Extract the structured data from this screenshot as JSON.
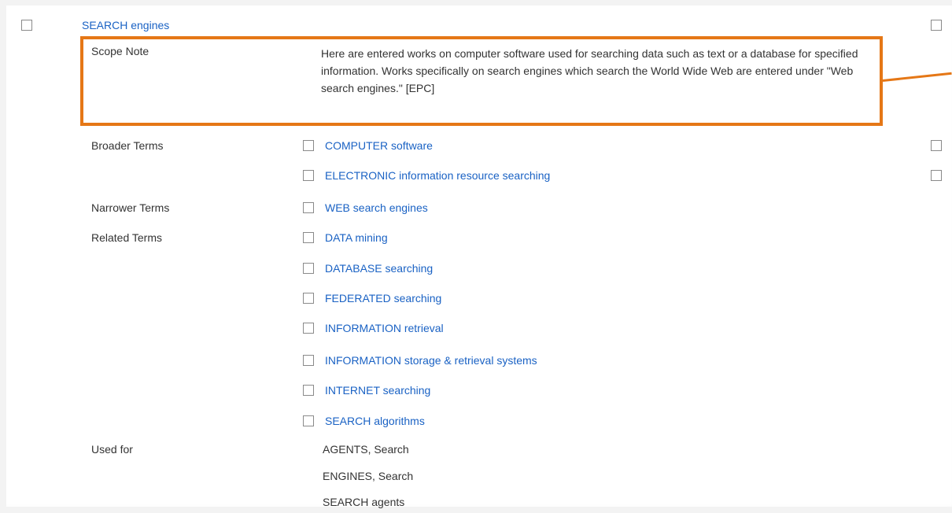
{
  "entry": {
    "heading": "SEARCH engines"
  },
  "scope_note": {
    "label": "Scope Note",
    "text": "Here are entered works on computer software used for searching data such as text or a database for specified information. Works specifically on search engines which search the World Wide Web are entered under \"Web search engines.\" [EPC]"
  },
  "broader_terms": {
    "label": "Broader Terms",
    "items": [
      "COMPUTER software",
      "ELECTRONIC information resource searching"
    ]
  },
  "narrower_terms": {
    "label": "Narrower Terms",
    "items": [
      "WEB search engines"
    ]
  },
  "related_terms": {
    "label": "Related Terms",
    "items": [
      "DATA mining",
      "DATABASE searching",
      "FEDERATED searching",
      "INFORMATION retrieval",
      "INFORMATION storage & retrieval systems",
      "INTERNET searching",
      "SEARCH algorithms"
    ]
  },
  "used_for": {
    "label": "Used for",
    "items": [
      "AGENTS, Search",
      "ENGINES, Search",
      "SEARCH agents"
    ]
  },
  "colors": {
    "link": "#1a62c4",
    "highlight": "#e57716",
    "text": "#333333"
  }
}
